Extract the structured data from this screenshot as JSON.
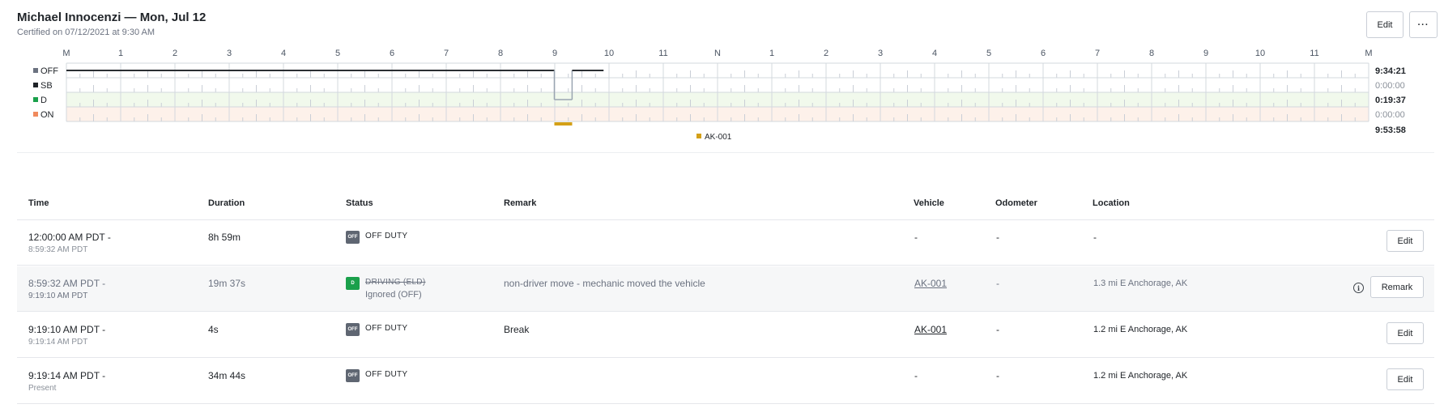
{
  "header": {
    "title": "Michael Innocenzi — Mon, Jul 12",
    "subtitle": "Certified on 07/12/2021 at 9:30 AM",
    "edit_label": "Edit",
    "more_label": "···"
  },
  "chart_data": {
    "type": "line",
    "hour_labels": [
      "M",
      "1",
      "2",
      "3",
      "4",
      "5",
      "6",
      "7",
      "8",
      "9",
      "10",
      "11",
      "N",
      "1",
      "2",
      "3",
      "4",
      "5",
      "6",
      "7",
      "8",
      "9",
      "10",
      "11",
      "M"
    ],
    "rows": [
      {
        "label": "OFF",
        "color": "#6b7280",
        "total": "9:34:21"
      },
      {
        "label": "SB",
        "color": "#1f2328",
        "total": "0:00:00"
      },
      {
        "label": "D",
        "color": "#1aa04b",
        "total": "0:19:37"
      },
      {
        "label": "ON",
        "color": "#f08a5d",
        "total": "0:00:00"
      }
    ],
    "grand_total": "9:53:58",
    "segments": [
      {
        "status": "OFF",
        "start_h": 0,
        "end_h": 8.9922
      },
      {
        "status": "D",
        "start_h": 8.9922,
        "end_h": 9.3194,
        "ignored": true
      },
      {
        "status": "OFF",
        "start_h": 9.3194,
        "end_h": 9.3206
      },
      {
        "status": "OFF",
        "start_h": 9.3206,
        "end_h": 9.8994
      }
    ],
    "vehicle_bar": {
      "name": "AK-001",
      "start_h": 8.9922,
      "end_h": 9.3206,
      "color": "#d4a017"
    },
    "legend": [
      {
        "name": "AK-001",
        "color": "#d4a017"
      }
    ]
  },
  "table": {
    "headers": {
      "time": "Time",
      "duration": "Duration",
      "status": "Status",
      "remark": "Remark",
      "vehicle": "Vehicle",
      "odometer": "Odometer",
      "location": "Location"
    },
    "rows": [
      {
        "time_start": "12:00:00 AM PDT -",
        "time_end": "8:59:32 AM PDT",
        "duration": "8h 59m",
        "status_badge": "OFF",
        "status_color": "#5f6672",
        "status": "OFF DUTY",
        "status_sub": "",
        "remark": "",
        "vehicle": "-",
        "odometer": "-",
        "location": "-",
        "action": "Edit"
      },
      {
        "time_start": "8:59:32 AM PDT -",
        "time_end": "9:19:10 AM PDT",
        "duration": "19m 37s",
        "status_badge": "D",
        "status_color": "#1aa04b",
        "status": "DRIVING (ELD)",
        "status_sub": "Ignored (OFF)",
        "remark": "non-driver move - mechanic moved the vehicle",
        "vehicle": "AK-001",
        "odometer": "-",
        "location": "1.3 mi E Anchorage, AK",
        "action": "Remark"
      },
      {
        "time_start": "9:19:10 AM PDT -",
        "time_end": "9:19:14 AM PDT",
        "duration": "4s",
        "status_badge": "OFF",
        "status_color": "#5f6672",
        "status": "OFF DUTY",
        "status_sub": "",
        "remark": "Break",
        "vehicle": "AK-001",
        "odometer": "-",
        "location": "1.2 mi E Anchorage, AK",
        "action": "Edit"
      },
      {
        "time_start": "9:19:14 AM PDT -",
        "time_end": "Present",
        "duration": "34m 44s",
        "status_badge": "OFF",
        "status_color": "#5f6672",
        "status": "OFF DUTY",
        "status_sub": "",
        "remark": "",
        "vehicle": "-",
        "odometer": "-",
        "location": "1.2 mi E Anchorage, AK",
        "action": "Edit"
      }
    ]
  }
}
